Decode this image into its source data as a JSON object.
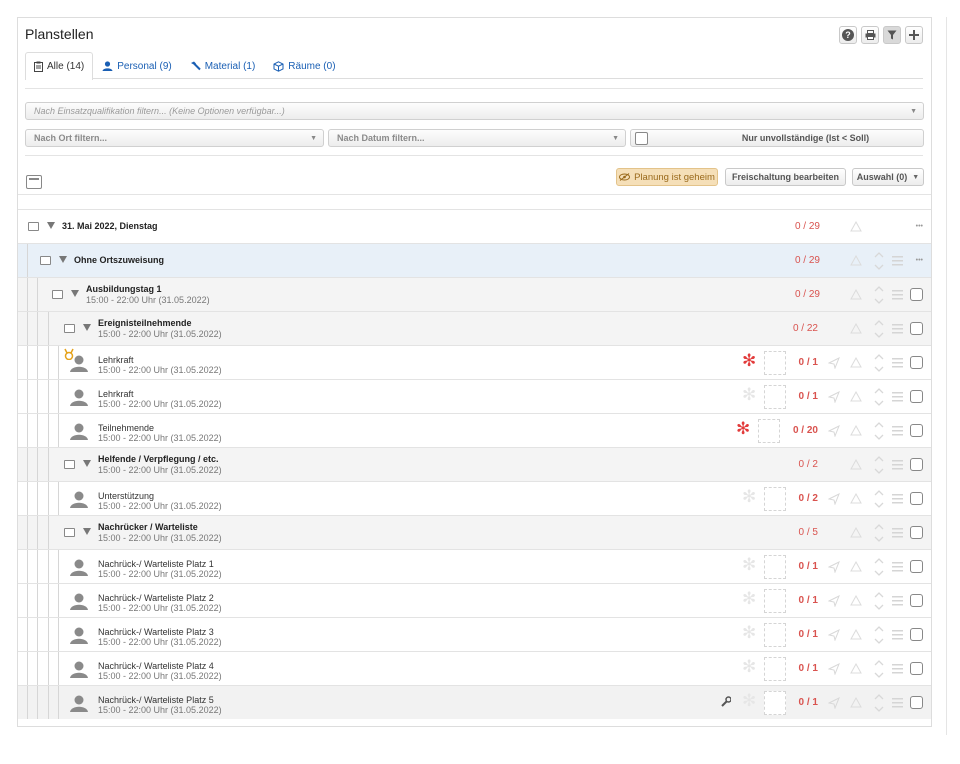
{
  "header": {
    "title": "Planstellen",
    "tools": [
      "help-icon",
      "print-icon",
      "filter-icon",
      "add-icon"
    ]
  },
  "tabs": [
    {
      "label": "Alle (14)",
      "icon": "clipboard-icon",
      "active": true
    },
    {
      "label": "Personal (9)",
      "icon": "person-icon",
      "active": false
    },
    {
      "label": "Material (1)",
      "icon": "hammer-icon",
      "active": false
    },
    {
      "label": "Räume (0)",
      "icon": "box-icon",
      "active": false
    }
  ],
  "filters": {
    "qualification_placeholder": "Nach Einsatzqualifikation filtern... (Keine Optionen verfügbar...)",
    "location_placeholder": "Nach Ort filtern...",
    "date_placeholder": "Nach Datum filtern...",
    "incomplete_label": "Nur unvollständige (Ist < Soll)"
  },
  "actions": {
    "secret_label": "Planung ist geheim",
    "unlock_label": "Freischaltung bearbeiten",
    "selection_label": "Auswahl (0)"
  },
  "colors": {
    "accent": "#1a5fb4",
    "count": "#d9534f",
    "required": "#e23b3b",
    "secret_bg": "#f5dfb8"
  },
  "rows": [
    {
      "type": "group",
      "level": 1,
      "title": "31. Mai 2022, Dienstag",
      "count": "0 / 29"
    },
    {
      "type": "group",
      "level": 2,
      "title": "Ohne Ortszuweisung",
      "count": "0 / 29"
    },
    {
      "type": "group",
      "level": 3,
      "title": "Ausbildungstag 1",
      "sub": "15:00 - 22:00 Uhr (31.05.2022)",
      "count": "0 / 29"
    },
    {
      "type": "group",
      "level": 4,
      "title": "Ereignisteilnehmende",
      "sub": "15:00 - 22:00 Uhr (31.05.2022)",
      "count": "0 / 22"
    },
    {
      "type": "position",
      "title": "Lehrkraft",
      "sub": "15:00 - 22:00 Uhr (31.05.2022)",
      "count": "0 / 1",
      "required": true,
      "badge": true
    },
    {
      "type": "position",
      "title": "Lehrkraft",
      "sub": "15:00 - 22:00 Uhr (31.05.2022)",
      "count": "0 / 1",
      "required": false
    },
    {
      "type": "position",
      "title": "Teilnehmende",
      "sub": "15:00 - 22:00 Uhr (31.05.2022)",
      "count": "0 / 20",
      "required": true
    },
    {
      "type": "group",
      "level": 4,
      "title": "Helfende / Verpflegung / etc.",
      "sub": "15:00 - 22:00 Uhr (31.05.2022)",
      "count": "0 / 2"
    },
    {
      "type": "position",
      "title": "Unterstützung",
      "sub": "15:00 - 22:00 Uhr (31.05.2022)",
      "count": "0 / 2",
      "required": false
    },
    {
      "type": "group",
      "level": 4,
      "title": "Nachrücker / Warteliste",
      "sub": "15:00 - 22:00 Uhr (31.05.2022)",
      "count": "0 / 5"
    },
    {
      "type": "position",
      "title": "Nachrück-/ Warteliste Platz 1",
      "sub": "15:00 - 22:00 Uhr (31.05.2022)",
      "count": "0 / 1",
      "required": false
    },
    {
      "type": "position",
      "title": "Nachrück-/ Warteliste Platz 2",
      "sub": "15:00 - 22:00 Uhr (31.05.2022)",
      "count": "0 / 1",
      "required": false
    },
    {
      "type": "position",
      "title": "Nachrück-/ Warteliste Platz 3",
      "sub": "15:00 - 22:00 Uhr (31.05.2022)",
      "count": "0 / 1",
      "required": false
    },
    {
      "type": "position",
      "title": "Nachrück-/ Warteliste Platz 4",
      "sub": "15:00 - 22:00 Uhr (31.05.2022)",
      "count": "0 / 1",
      "required": false
    },
    {
      "type": "position",
      "title": "Nachrück-/ Warteliste Platz 5",
      "sub": "15:00 - 22:00 Uhr (31.05.2022)",
      "count": "0 / 1",
      "required": false,
      "wrench": true,
      "hover": true
    }
  ]
}
